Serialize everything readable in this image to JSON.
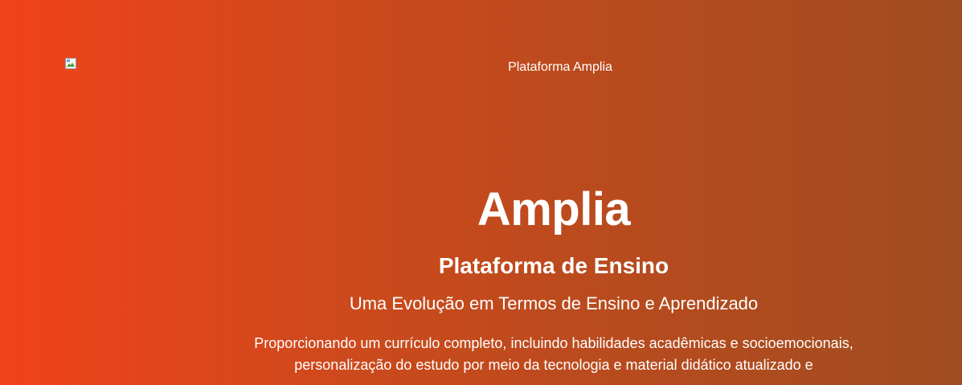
{
  "header": {
    "logo_alt": "Plataforma Amplia"
  },
  "hero": {
    "title": "Amplia",
    "subtitle": "Plataforma de Ensino",
    "tagline": "Uma Evolução em Termos de Ensino e Aprendizado",
    "description": "Proporcionando um currículo completo, incluindo habilidades acadêmicas e socioemocionais, personalização do estudo por meio da tecnologia e material didático atualizado e"
  },
  "colors": {
    "gradient_start": "#f1421c",
    "gradient_end": "#9f4c20",
    "text": "#ffffff"
  },
  "icons": {
    "broken_image": "broken-image-icon"
  }
}
